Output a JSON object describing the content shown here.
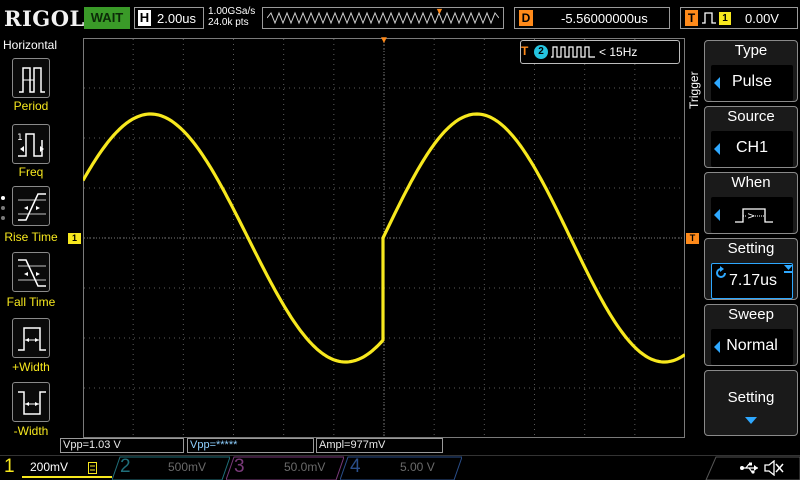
{
  "top_bar": {
    "logo": "RIGOL",
    "run_status": "WAIT",
    "horizontal": {
      "letter": "H",
      "value": "2.00us"
    },
    "sample_rate": "1.00GSa/s",
    "memory_depth": "24.0k pts",
    "delay": {
      "letter": "D",
      "value": "-5.56000000us"
    },
    "trigger": {
      "letter": "T",
      "source_badge": "1",
      "level": "0.00V"
    }
  },
  "left_menu": {
    "title": "Horizontal",
    "items": [
      {
        "label": "Period",
        "icon": "period-icon"
      },
      {
        "label": "Freq",
        "icon": "frequency-icon"
      },
      {
        "label": "Rise Time",
        "icon": "rise-time-icon"
      },
      {
        "label": "Fall Time",
        "icon": "fall-time-icon"
      },
      {
        "label": "+Width",
        "icon": "positive-width-icon"
      },
      {
        "label": "-Width",
        "icon": "negative-width-icon"
      }
    ]
  },
  "screen": {
    "ch1_marker": "1",
    "trigger_level_marker": "T",
    "trigger_readout": {
      "t_icon": "T",
      "channel_badge": "2",
      "condition": "< 15Hz"
    },
    "waveform": {
      "channel": "CH1",
      "color": "#f7e81e",
      "shape": "sine-with-discontinuity"
    }
  },
  "measurements": [
    {
      "text": "Vpp=1.03 V"
    },
    {
      "text": "Vpp=*****"
    },
    {
      "text": "Ampl=977mV"
    }
  ],
  "right_menu": {
    "title": "Trigger",
    "items": [
      {
        "label": "Type",
        "value": "Pulse"
      },
      {
        "label": "Source",
        "value": "CH1"
      },
      {
        "label": "When",
        "value": "",
        "value_icon": "pulse-width-greater-icon"
      },
      {
        "label": "Setting",
        "value": "7.17us",
        "value_icon": "rotate-knob-icon"
      },
      {
        "label": "Sweep",
        "value": "Normal"
      },
      {
        "label": "Setting",
        "value": ""
      }
    ]
  },
  "bottom_bar": {
    "channels": [
      {
        "num": "1",
        "scale": "200mV",
        "color": "#f7e81e",
        "active": true
      },
      {
        "num": "2",
        "scale": "500mV",
        "color": "#1f6f7a",
        "active": false
      },
      {
        "num": "3",
        "scale": "50.0mV",
        "color": "#7a3a7a",
        "active": false
      },
      {
        "num": "4",
        "scale": "5.00 V",
        "color": "#2a4e8a",
        "active": false
      }
    ]
  },
  "colors": {
    "ch1": "#f7e81e",
    "trigger": "#ff8a1a",
    "run_status_bg": "#3a9a28",
    "menu_accent": "#2ea8ff"
  }
}
